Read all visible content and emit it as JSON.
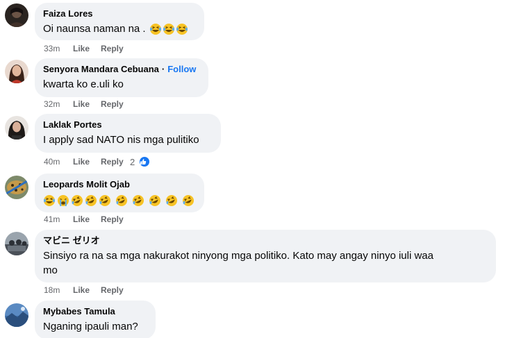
{
  "comments": [
    {
      "author": "Faiza Lores",
      "text": "Oi naunsa naman na .",
      "emojis": [
        "laughing-tears",
        "laughing-tears",
        "laughing-tears"
      ],
      "time": "33m",
      "like_label": "Like",
      "reply_label": "Reply"
    },
    {
      "author": "Senyora Mandara Cebuana",
      "follow_label": "Follow",
      "text": "kwarta ko e.uli ko",
      "time": "32m",
      "like_label": "Like",
      "reply_label": "Reply"
    },
    {
      "author": "Laklak Portes",
      "text": "I apply sad NATO nis mga pulitiko",
      "time": "40m",
      "like_label": "Like",
      "reply_label": "Reply",
      "reaction_count": "2",
      "reaction_type": "like"
    },
    {
      "author": "Leopards Molit Ojab",
      "emojis": [
        "laughing-tears",
        "crying-loudly",
        "rolling-laughing",
        "rolling-laughing",
        "rolling-laughing",
        "rolling-laughing",
        "rolling-laughing",
        "rolling-laughing",
        "rolling-laughing",
        "rolling-laughing"
      ],
      "time": "41m",
      "like_label": "Like",
      "reply_label": "Reply"
    },
    {
      "author": "マビニ ゼリオ",
      "text_line1": "Sinsiyo ra na sa mga nakurakot ninyong mga politiko. Kato may angay ninyo iuli waa",
      "text_line2": "mo",
      "time": "18m",
      "like_label": "Like",
      "reply_label": "Reply"
    },
    {
      "author": "Mybabes Tamula",
      "text": "Nganing ipauli man?"
    }
  ],
  "colors": {
    "bubble": "#f0f2f5",
    "meta_text": "#65676b",
    "follow": "#1877f2",
    "like_reaction": "#1877f2"
  }
}
